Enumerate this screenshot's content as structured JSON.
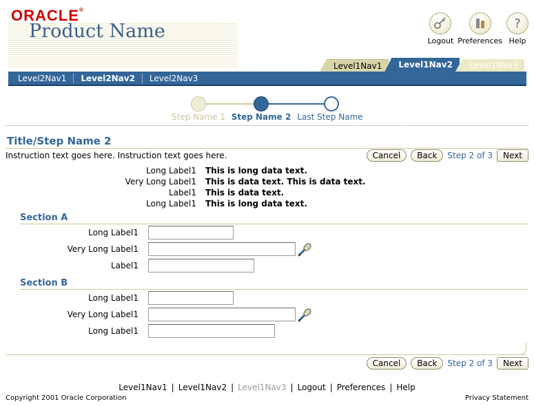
{
  "brand": {
    "logo": "ORACLE",
    "product_name": "Product Name"
  },
  "global_buttons": {
    "logout": "Logout",
    "preferences": "Preferences",
    "help": "Help"
  },
  "tabs_level1": [
    "Level1Nav1",
    "Level1Nav2",
    "Level1Nav3"
  ],
  "tabs_level2": [
    "Level2Nav1",
    "Level2Nav2",
    "Level2Nav3"
  ],
  "train": {
    "steps": [
      "Step Name 1",
      "Step Name 2",
      "Last Step Name"
    ],
    "current": 1
  },
  "page": {
    "title": "Title/Step Name 2",
    "instruction": "Instruction text goes here. Instruction text goes here."
  },
  "buttons": {
    "cancel": "Cancel",
    "back": "Back",
    "step_indicator": "Step 2 of 3",
    "next": "Next"
  },
  "readonly": [
    {
      "label": "Long Label1",
      "value": "This is long data text."
    },
    {
      "label": "Very Long Label1",
      "value": "This is data text. This is data text."
    },
    {
      "label": "Label1",
      "value": "This is data text."
    },
    {
      "label": "Long Label1",
      "value": "This is long data text."
    }
  ],
  "section_a": {
    "title": "Section A",
    "fields": [
      {
        "label": "Long Label1",
        "value": ""
      },
      {
        "label": "Very Long Label1",
        "value": ""
      },
      {
        "label": "Label1",
        "value": ""
      }
    ]
  },
  "section_b": {
    "title": "Section B",
    "fields": [
      {
        "label": "Long Label1",
        "value": ""
      },
      {
        "label": "Very Long Label1",
        "value": ""
      },
      {
        "label": "Long Label1",
        "value": ""
      }
    ]
  },
  "footer": {
    "links": [
      "Level1Nav1",
      "Level1Nav2",
      "Level1Nav3",
      "Logout",
      "Preferences",
      "Help"
    ],
    "separator": "|",
    "copyright": "Copyright 2001 Oracle Corporation",
    "privacy": "Privacy Statement"
  },
  "colors": {
    "accent": "#336699",
    "tan": "#d9d5a9",
    "brand_red": "#cc0000",
    "train_inactive": "#efedd6"
  }
}
